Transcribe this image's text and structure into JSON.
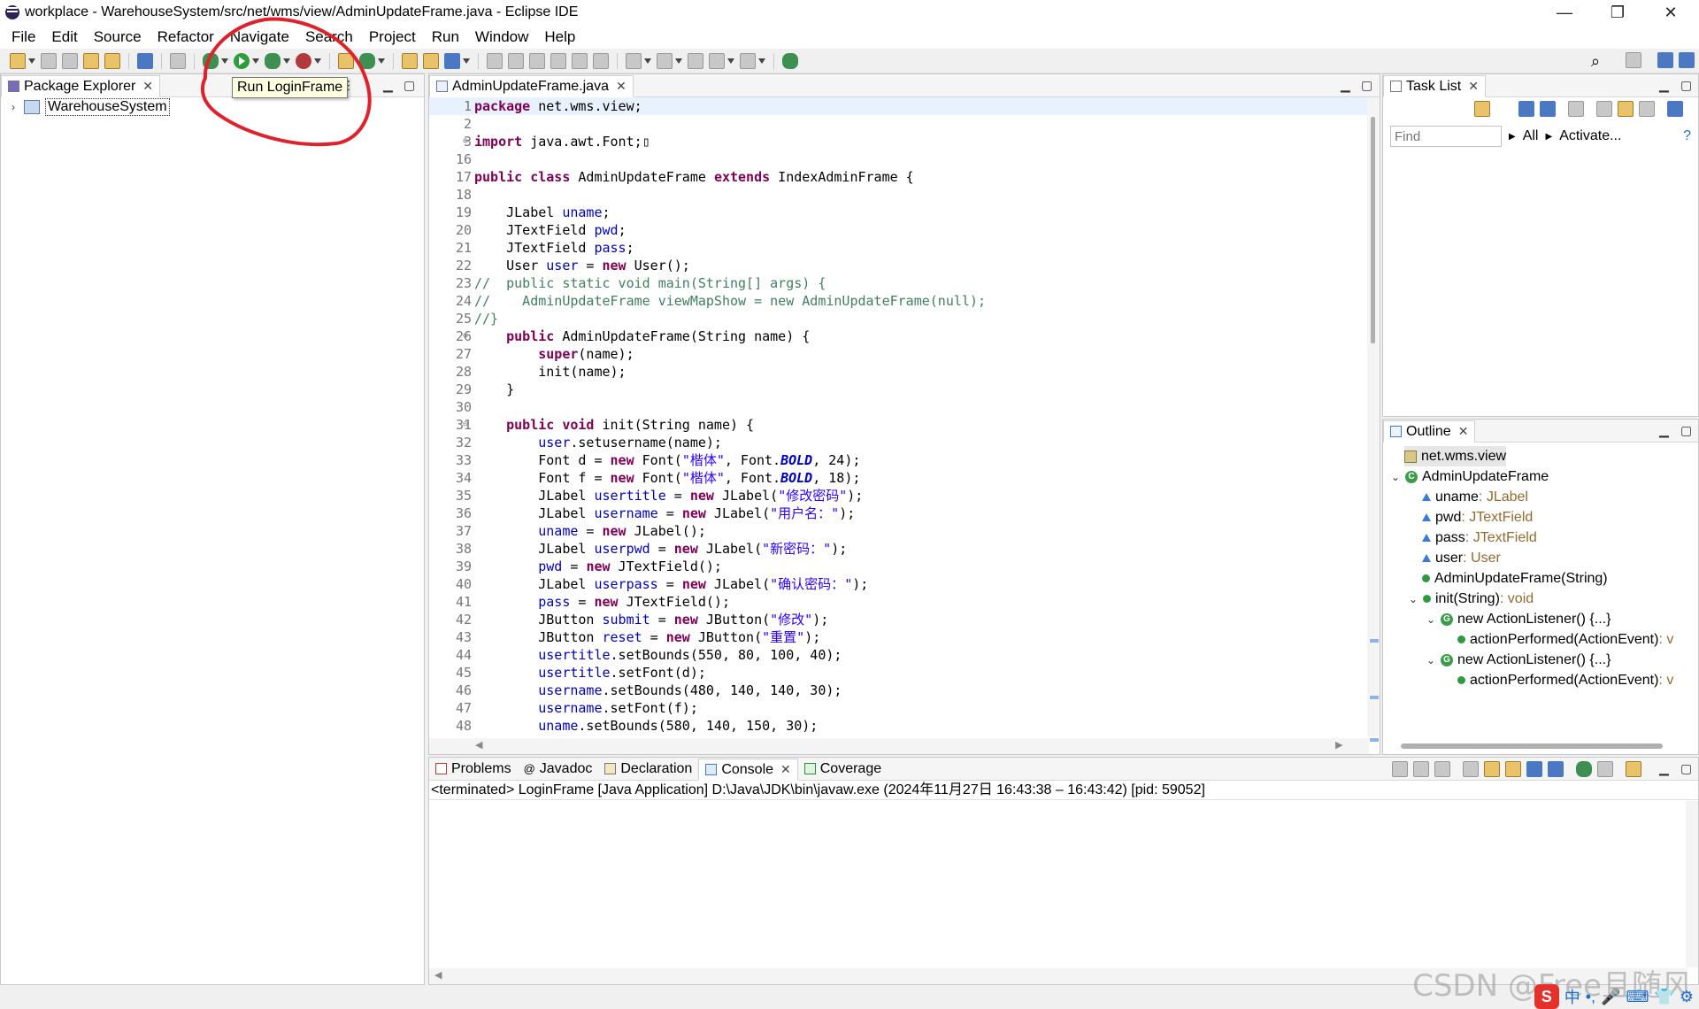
{
  "window": {
    "title": "workplace - WarehouseSystem/src/net/wms/view/AdminUpdateFrame.java - Eclipse IDE",
    "controls": {
      "minimize": "—",
      "restore": "❐",
      "close": "✕"
    }
  },
  "menu": [
    "File",
    "Edit",
    "Source",
    "Refactor",
    "Navigate",
    "Search",
    "Project",
    "Run",
    "Window",
    "Help"
  ],
  "tooltip": "Run LoginFrame",
  "package_explorer": {
    "tab_label": "Package Explorer",
    "project": "WarehouseSystem"
  },
  "editor": {
    "tab_label": "AdminUpdateFrame.java",
    "lines": [
      {
        "n": "1",
        "html": "<span class=\"kw\">package</span> net.wms.view;"
      },
      {
        "n": "2",
        "html": ""
      },
      {
        "n": "3",
        "fold": "⊕",
        "html": "<span class=\"kw\">import</span> java.awt.Font;▯"
      },
      {
        "n": "16",
        "html": ""
      },
      {
        "n": "17",
        "html": "<span class=\"kw\">public</span> <span class=\"kw\">class</span> AdminUpdateFrame <span class=\"kw\">extends</span> IndexAdminFrame {"
      },
      {
        "n": "18",
        "html": ""
      },
      {
        "n": "19",
        "html": "    JLabel <span class=\"fd\">uname</span>;"
      },
      {
        "n": "20",
        "html": "    JTextField <span class=\"fd\">pwd</span>;"
      },
      {
        "n": "21",
        "html": "    JTextField <span class=\"fd\">pass</span>;"
      },
      {
        "n": "22",
        "html": "    User <span class=\"fd\">user</span> = <span class=\"kw\">new</span> User();"
      },
      {
        "n": "23",
        "html": "<span class=\"cm\">//  public static void main(String[] args) {</span>"
      },
      {
        "n": "24",
        "html": "<span class=\"cm\">//    AdminUpdateFrame viewMapShow = new AdminUpdateFrame(null);</span>"
      },
      {
        "n": "25",
        "html": "<span class=\"cm\">//}</span>"
      },
      {
        "n": "26",
        "fold": "⊖",
        "html": "    <span class=\"kw\">public</span> AdminUpdateFrame(String name) {"
      },
      {
        "n": "27",
        "html": "        <span class=\"kw\">super</span>(name);"
      },
      {
        "n": "28",
        "html": "        init(name);"
      },
      {
        "n": "29",
        "html": "    }"
      },
      {
        "n": "30",
        "html": ""
      },
      {
        "n": "31",
        "fold": "⊖",
        "html": "    <span class=\"kw\">public</span> <span class=\"kw\">void</span> init(String name) {"
      },
      {
        "n": "32",
        "html": "        <span class=\"fd\">user</span>.setusername(name);"
      },
      {
        "n": "33",
        "html": "        Font d = <span class=\"kw\">new</span> Font(<span class=\"st\">\"楷体\"</span>, Font.<span class=\"sf\">BOLD</span>, 24);"
      },
      {
        "n": "34",
        "html": "        Font f = <span class=\"kw\">new</span> Font(<span class=\"st\">\"楷体\"</span>, Font.<span class=\"sf\">BOLD</span>, 18);"
      },
      {
        "n": "35",
        "html": "        JLabel <span class=\"fd\">usertitle</span> = <span class=\"kw\">new</span> JLabel(<span class=\"st\">\"修改密码\"</span>);"
      },
      {
        "n": "36",
        "html": "        JLabel <span class=\"fd\">username</span> = <span class=\"kw\">new</span> JLabel(<span class=\"st\">\"用户名：\"</span>);"
      },
      {
        "n": "37",
        "html": "        <span class=\"fd\">uname</span> = <span class=\"kw\">new</span> JLabel();"
      },
      {
        "n": "38",
        "html": "        JLabel <span class=\"fd\">userpwd</span> = <span class=\"kw\">new</span> JLabel(<span class=\"st\">\"新密码：\"</span>);"
      },
      {
        "n": "39",
        "html": "        <span class=\"fd\">pwd</span> = <span class=\"kw\">new</span> JTextField();"
      },
      {
        "n": "40",
        "html": "        JLabel <span class=\"fd\">userpass</span> = <span class=\"kw\">new</span> JLabel(<span class=\"st\">\"确认密码：\"</span>);"
      },
      {
        "n": "41",
        "html": "        <span class=\"fd\">pass</span> = <span class=\"kw\">new</span> JTextField();"
      },
      {
        "n": "42",
        "html": "        JButton <span class=\"fd\">submit</span> = <span class=\"kw\">new</span> JButton(<span class=\"st\">\"修改\"</span>);"
      },
      {
        "n": "43",
        "html": "        JButton <span class=\"fd\">reset</span> = <span class=\"kw\">new</span> JButton(<span class=\"st\">\"重置\"</span>);"
      },
      {
        "n": "44",
        "html": "        <span class=\"fd\">usertitle</span>.setBounds(550, 80, 100, 40);"
      },
      {
        "n": "45",
        "html": "        <span class=\"fd\">usertitle</span>.setFont(d);"
      },
      {
        "n": "46",
        "html": "        <span class=\"fd\">username</span>.setBounds(480, 140, 140, 30);"
      },
      {
        "n": "47",
        "html": "        <span class=\"fd\">username</span>.setFont(f);"
      },
      {
        "n": "48",
        "html": "        <span class=\"fd\">uname</span>.setBounds(580, 140, 150, 30);"
      }
    ]
  },
  "task_list": {
    "tab_label": "Task List",
    "find_placeholder": "Find",
    "all_label": "All",
    "activate_label": "Activate..."
  },
  "outline": {
    "tab_label": "Outline",
    "items": [
      {
        "kind": "package",
        "label": "net.wms.view",
        "type": ""
      },
      {
        "kind": "class",
        "label": "AdminUpdateFrame",
        "type": ""
      },
      {
        "kind": "field",
        "label": "uname",
        "type": " : JLabel"
      },
      {
        "kind": "field",
        "label": "pwd",
        "type": " : JTextField"
      },
      {
        "kind": "field",
        "label": "pass",
        "type": " : JTextField"
      },
      {
        "kind": "field",
        "label": "user",
        "type": " : User"
      },
      {
        "kind": "ctor",
        "label": "AdminUpdateFrame(String)",
        "type": ""
      },
      {
        "kind": "method",
        "label": "init(String)",
        "type": " : void"
      },
      {
        "kind": "anon",
        "label": "new ActionListener() {...}",
        "type": ""
      },
      {
        "kind": "method2",
        "label": "actionPerformed(ActionEvent)",
        "type": " : v"
      },
      {
        "kind": "anon",
        "label": "new ActionListener() {...}",
        "type": ""
      },
      {
        "kind": "method2",
        "label": "actionPerformed(ActionEvent)",
        "type": " : v"
      }
    ]
  },
  "console": {
    "tabs": [
      "Problems",
      "Javadoc",
      "Declaration",
      "Console",
      "Coverage"
    ],
    "status": "<terminated> LoginFrame [Java Application] D:\\Java\\JDK\\bin\\javaw.exe  (2024年11月27日 16:43:38 – 16:43:42) [pid: 59052]"
  },
  "watermark": "CSDN @Free且随风",
  "tray": [
    "中",
    "•,",
    "🎤",
    "⌨",
    "👕",
    "⚙"
  ],
  "colors": {
    "keyword": "#7f0055",
    "field": "#0000c0",
    "string": "#2a00ff",
    "comment": "#3f7f5f",
    "annotation": "#e0202a"
  }
}
